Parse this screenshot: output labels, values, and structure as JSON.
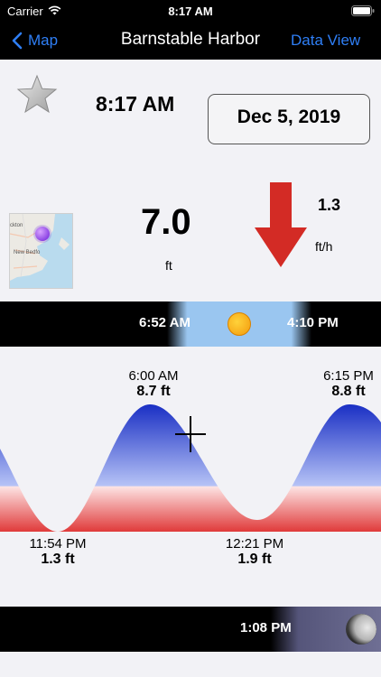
{
  "status": {
    "carrier": "Carrier",
    "time": "8:17 AM"
  },
  "nav": {
    "back_label": "Map",
    "title": "Barnstable Harbor",
    "right_label": "Data View"
  },
  "info": {
    "current_time": "8:17 AM",
    "date": "Dec 5, 2019",
    "height_value": "7.0",
    "height_unit": "ft",
    "rate_value": "1.3",
    "rate_unit": "ft/h",
    "map_labels": {
      "town1": "ckton",
      "town2": "New Bedfo"
    }
  },
  "sun": {
    "sunrise": "6:52 AM",
    "sunset": "4:10 PM"
  },
  "tides": {
    "highs": [
      {
        "time": "6:00 AM",
        "height": "8.7 ft"
      },
      {
        "time": "6:15 PM",
        "height": "8.8 ft"
      }
    ],
    "lows": [
      {
        "time": "11:54 PM",
        "height": "1.3 ft"
      },
      {
        "time": "12:21 PM",
        "height": "1.9 ft"
      }
    ]
  },
  "moon": {
    "time": "1:08 PM"
  },
  "colors": {
    "accent": "#2f7ff6",
    "arrow": "#d32b25",
    "tide_top": "#1a2fc4",
    "tide_bottom": "#e03a3a"
  }
}
